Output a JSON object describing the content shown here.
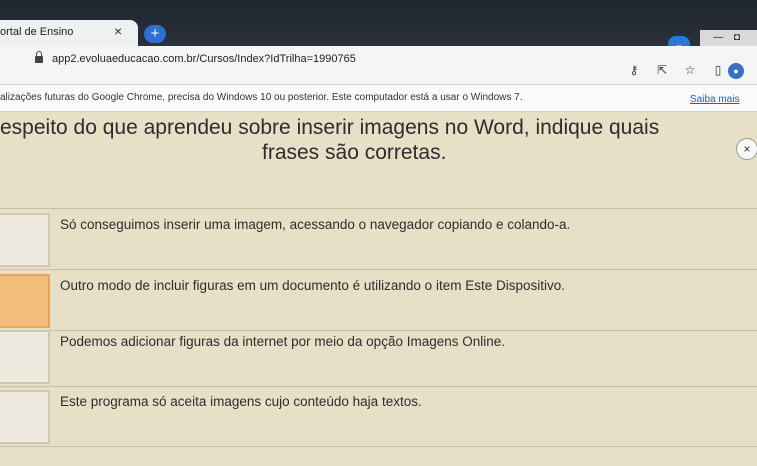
{
  "browser": {
    "tab_title": "ortal de Ensino",
    "tab_close": "×",
    "new_tab": "+",
    "url": "app2.evoluaeducacao.com.br/Cursos/Index?IdTrilha=1990765",
    "window_controls": "— ◘",
    "profile_chip": "⌄",
    "avatar": "●"
  },
  "infobar": {
    "message": "alizações futuras do Google Chrome, precisa do Windows 10 ou posterior. Este computador está a usar o Windows 7.",
    "link": "Saiba mais"
  },
  "question": {
    "line1": "espeito do que aprendeu sobre inserir imagens no Word, indique quais",
    "line2": "frases são corretas."
  },
  "close_symbol": "×",
  "options": [
    {
      "text": "Só conseguimos inserir uma imagem, acessando o navegador copiando e colando-a.",
      "selected": false
    },
    {
      "text": "Outro modo de incluir figuras em um documento é utilizando o item Este Dispositivo.",
      "selected": true
    },
    {
      "text": "Podemos adicionar figuras da internet por meio da opção Imagens Online.",
      "selected": false
    },
    {
      "text": "Este programa só aceita imagens cujo conteúdo haja textos.",
      "selected": false
    }
  ],
  "colors": {
    "page_background": "#e7dfc6",
    "selected_box": "#f2bd78",
    "link": "#1a62c9"
  }
}
